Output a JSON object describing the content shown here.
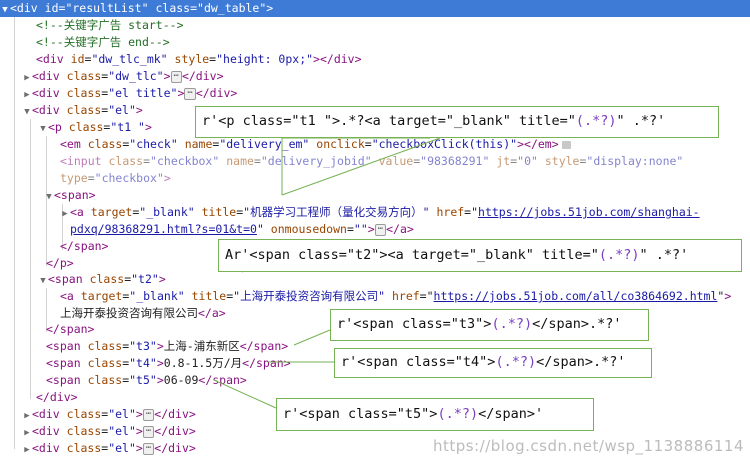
{
  "tree": {
    "root": {
      "tag_open": "<div",
      "id_attr": "id",
      "id_val": "\"resultList\"",
      "class_attr": "class",
      "class_val": "\"dw_table\"",
      "close": ">"
    },
    "comment_start": "<!--关键字广告 start-->",
    "comment_end": "<!--关键字广告 end-->",
    "dw_tlc_mk": {
      "open": "<div",
      "id_attr": "id",
      "id_val": "\"dw_tlc_mk\"",
      "style_attr": "style",
      "style_val": "\"height: 0px;\"",
      "close": "></div>"
    },
    "dw_tlc": {
      "open": "<div",
      "class_attr": "class",
      "class_val": "\"dw_tlc\"",
      "close1": ">",
      "close2": "</div>"
    },
    "el_title": {
      "open": "<div",
      "class_attr": "class",
      "class_val": "\"el title\"",
      "close1": ">",
      "close2": "</div>"
    },
    "el_open": {
      "open": "<div",
      "class_attr": "class",
      "class_val": "\"el\"",
      "close": ">"
    },
    "p_t1": {
      "open": "<p",
      "class_attr": "class",
      "class_val": "\"t1 \"",
      "close": ">"
    },
    "em": {
      "open": "<em",
      "class_attr": "class",
      "class_val": "\"check\"",
      "name_attr": "name",
      "name_val": "\"delivery_em\"",
      "onclick_attr": "onclick",
      "onclick_val": "\"checkboxClick(this)\"",
      "close": "></em>"
    },
    "input": {
      "open": "<input",
      "class_attr": "class",
      "class_val": "\"checkbox\"",
      "name_attr": "name",
      "name_val": "\"delivery_jobid\"",
      "value_attr": "value",
      "value_val": "\"98368291\"",
      "jt_attr": "jt",
      "jt_val": "\"0\"",
      "style_attr": "style",
      "style_val": "\"display:none\""
    },
    "input_type": {
      "type_attr": "type",
      "type_val": "\"checkbox\"",
      "close": ">"
    },
    "span_open": "<span>",
    "a_job": {
      "open": "<a",
      "target_attr": "target",
      "target_val": "\"_blank\"",
      "title_attr": "title",
      "title_val": "\"机器学习工程师（量化交易方向）\"",
      "href_attr": "href",
      "href_val": "https://jobs.51job.com/shanghai-"
    },
    "a_job_cont": {
      "href_val2": "pdxq/98368291.html?s=01&t=0",
      "onmouse_attr": "onmousedown",
      "onmouse_val": "\"\"",
      "close1": ">",
      "close2": "</a>"
    },
    "span_close": "</span>",
    "p_close": "</p>",
    "span_t2": {
      "open": "<span",
      "class_attr": "class",
      "class_val": "\"t2\"",
      "close": ">"
    },
    "a_co": {
      "open": "<a",
      "target_attr": "target",
      "target_val": "\"_blank\"",
      "title_attr": "title",
      "title_val": "\"上海开泰投资咨询有限公司\"",
      "href_attr": "href",
      "href_val": "https://jobs.51job.com/all/co3864692.html",
      "close": ">"
    },
    "a_co_text": "上海开泰投资咨询有限公司",
    "a_close": "</a>",
    "span_t2_close": "</span>",
    "span_t3": {
      "open": "<span",
      "class_attr": "class",
      "class_val": "\"t3\"",
      "close": ">",
      "text": "上海-浦东新区",
      "end": "</span>"
    },
    "span_t4": {
      "open": "<span",
      "class_attr": "class",
      "class_val": "\"t4\"",
      "close": ">",
      "text": "0.8-1.5万/月",
      "end": "</span>"
    },
    "span_t5": {
      "open": "<span",
      "class_attr": "class",
      "class_val": "\"t5\"",
      "close": ">",
      "text": "06-09",
      "end": "</span>"
    },
    "div_close": "</div>",
    "el_collapsed": {
      "open": "<div",
      "class_attr": "class",
      "class_val": "\"el\"",
      "close1": ">",
      "close2": "</div>"
    },
    "ellipsis": "⋯"
  },
  "callouts": {
    "c1": {
      "pre": "r'<p class=\"t1 \">.*?<a target=\"_blank\" title=\"",
      "grp": "(.*?)",
      "post": "\" .*?'"
    },
    "c2": {
      "pre": "Ar'<span class=\"t2\"><a target=\"_blank\" title=\"",
      "grp": "(.*?)",
      "post": "\" .*?'"
    },
    "c3": {
      "pre": "r'<span class=\"t3\">",
      "grp": "(.*?)",
      "post": "</span>.*?'"
    },
    "c4": {
      "pre": "r'<span class=\"t4\">",
      "grp": "(.*?)",
      "post": "</span>.*?'"
    },
    "c5": {
      "pre": "r'<span class=\"t5\">",
      "grp": "(.*?)",
      "post": "</span>'"
    }
  },
  "watermark": "https://blog.csdn.net/wsp_1138886114",
  "colors": {
    "selection": "#3e7bd6",
    "callout_border": "#77b255",
    "tag": "#881280",
    "attr": "#994500",
    "value": "#1a1aa6",
    "comment": "#236e25",
    "regex_group": "#7a3fc0"
  }
}
